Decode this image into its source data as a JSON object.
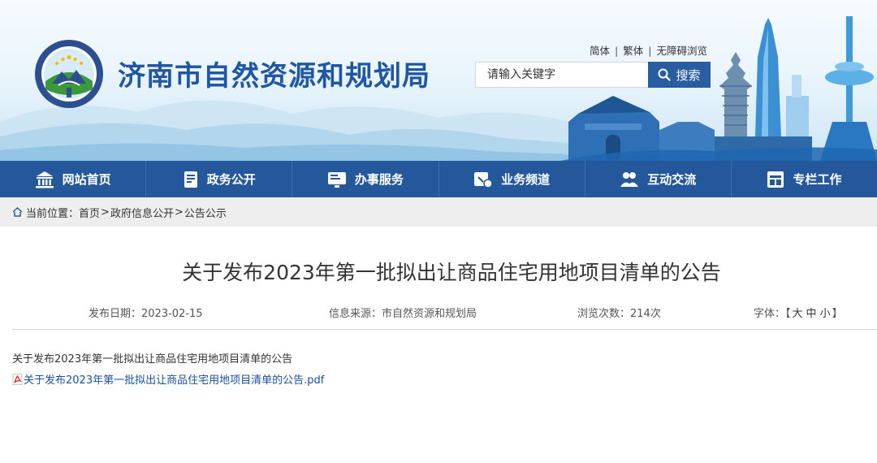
{
  "header": {
    "site_title": "济南市自然资源和规划局",
    "top_links": [
      "简体",
      "繁体",
      "无障碍浏览"
    ],
    "search_placeholder": "请输入关键字",
    "search_button": "搜索",
    "logo_icon": "emblem-seal-icon",
    "scenery": "city-skyline-illustration"
  },
  "nav": {
    "items": [
      {
        "label": "网站首页",
        "icon": "institution-icon"
      },
      {
        "label": "政务公开",
        "icon": "document-icon"
      },
      {
        "label": "办事服务",
        "icon": "service-screen-icon"
      },
      {
        "label": "业务频道",
        "icon": "channel-icon"
      },
      {
        "label": "互动交流",
        "icon": "people-icon"
      },
      {
        "label": "专栏工作",
        "icon": "window-icon"
      }
    ]
  },
  "breadcrumb": {
    "prefix": "当前位置：",
    "items": [
      "首页",
      "政府信息公开",
      "公告公示"
    ],
    "separator": ">"
  },
  "article": {
    "title": "关于发布2023年第一批拟出让商品住宅用地项目清单的公告",
    "date": "发布日期：2023-02-15",
    "source": "信息来源：市自然资源和规划局",
    "views": "浏览次数：214次",
    "font_label": "字体：",
    "font_open": "【",
    "font_sizes": [
      "大",
      "中",
      "小"
    ],
    "font_close": "】",
    "body_text": "关于发布2023年第一批拟出让商品住宅用地项目清单的公告",
    "attachment": "关于发布2023年第一批拟出让商品住宅用地项目清单的公告.pdf"
  },
  "colors": {
    "nav_bg": "#25589b",
    "title_blue": "#1f57a5",
    "link_blue": "#1c4f99",
    "search_btn": "#2a5d9f"
  }
}
